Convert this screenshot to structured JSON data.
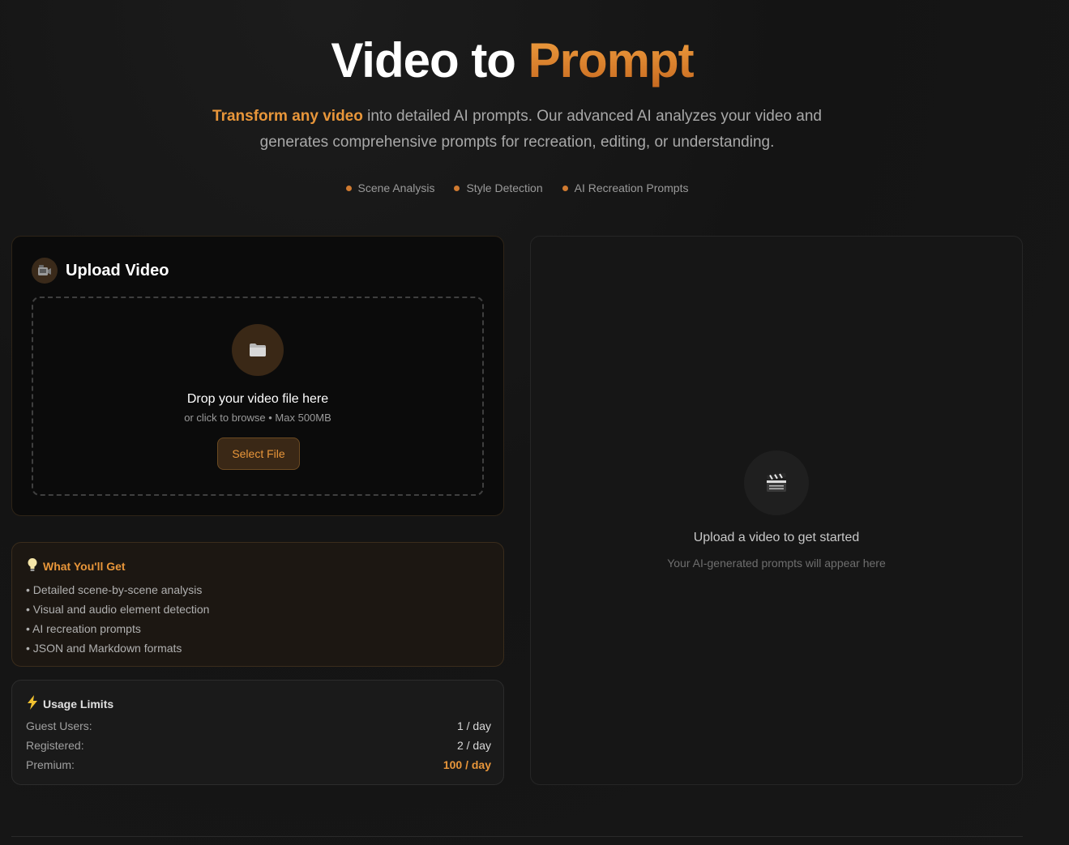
{
  "hero": {
    "title_main": "Video to ",
    "title_accent": "Prompt",
    "subtitle_highlight": "Transform any video",
    "subtitle_rest": " into detailed AI prompts. Our advanced AI analyzes your video and generates comprehensive prompts for recreation, editing, or understanding.",
    "features": [
      "Scene Analysis",
      "Style Detection",
      "AI Recreation Prompts"
    ]
  },
  "upload": {
    "heading": "Upload Video",
    "heading_icon": "video-camera-icon",
    "drop_title": "Drop your video file here",
    "drop_subtitle": "or click to browse • Max 500MB",
    "drop_icon": "folder-icon",
    "select_button": "Select File"
  },
  "what_youll_get": {
    "heading": "What You'll Get",
    "icon": "lightbulb-icon",
    "items": [
      "• Detailed scene-by-scene analysis",
      "• Visual and audio element detection",
      "• AI recreation prompts",
      "• JSON and Markdown formats"
    ]
  },
  "usage_limits": {
    "heading": "Usage Limits",
    "icon": "lightning-icon",
    "rows": [
      {
        "label": "Guest Users:",
        "value": "1 / day"
      },
      {
        "label": "Registered:",
        "value": "2 / day"
      },
      {
        "label": "Premium:",
        "value": "100 / day"
      }
    ]
  },
  "output": {
    "icon": "clapperboard-icon",
    "title": "Upload a video to get started",
    "subtitle": "Your AI-generated prompts will appear here"
  },
  "colors": {
    "accent": "#e8963a",
    "background": "#141414"
  }
}
